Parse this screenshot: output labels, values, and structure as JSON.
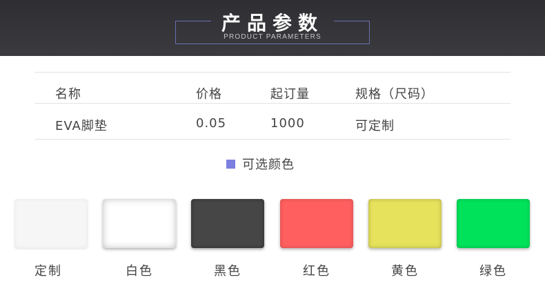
{
  "banner": {
    "title": "产品参数",
    "subtitle": "PRODUCT PARAMETERS"
  },
  "table": {
    "headers": [
      "名称",
      "价格",
      "起订量",
      "规格（尺码）"
    ],
    "rows": [
      [
        "EVA脚垫",
        "0.05",
        "1000",
        "可定制"
      ]
    ]
  },
  "colors": {
    "heading": "可选颜色",
    "accent": "#7b7fe0",
    "swatches": [
      {
        "label": "定制",
        "color": "#f6f6f6"
      },
      {
        "label": "白色",
        "color": "#ffffff"
      },
      {
        "label": "黑色",
        "color": "#464646"
      },
      {
        "label": "红色",
        "color": "#ff5f5f"
      },
      {
        "label": "黄色",
        "color": "#e6e25c"
      },
      {
        "label": "绿色",
        "color": "#00e25a"
      }
    ]
  }
}
